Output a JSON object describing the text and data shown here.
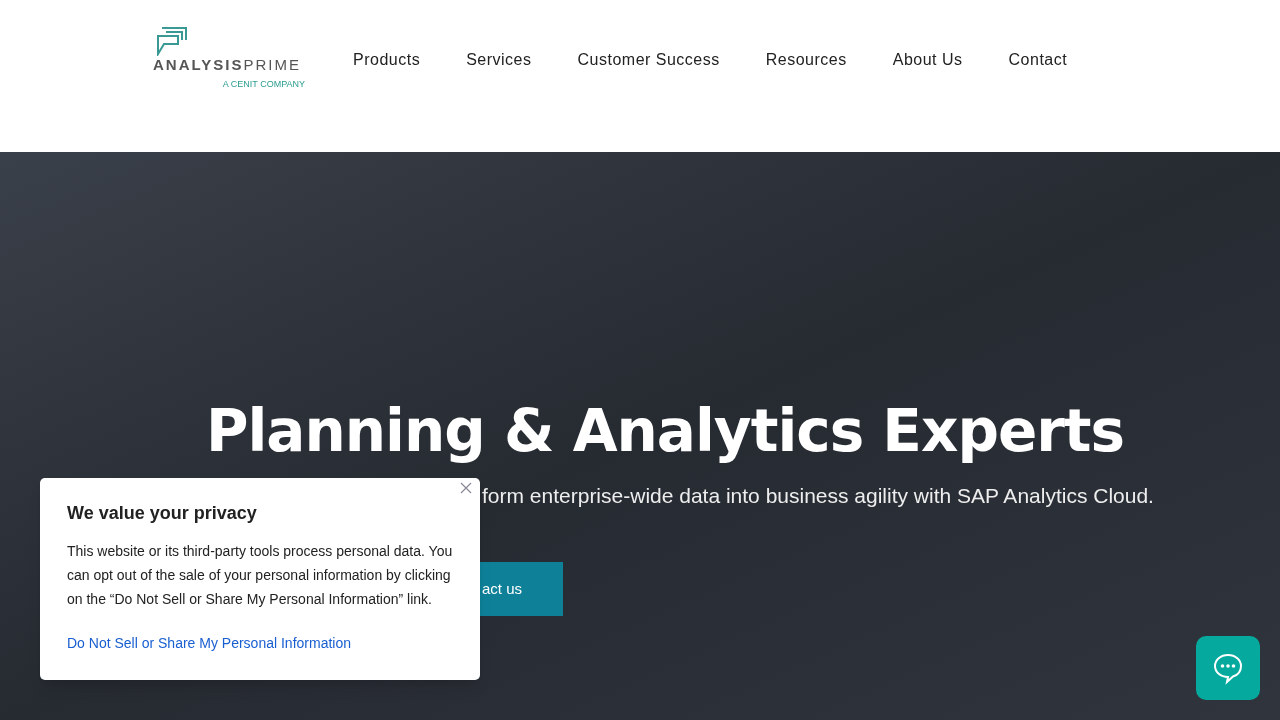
{
  "logo": {
    "wordmark_bold": "ANALYSIS",
    "wordmark_light": "PRIME",
    "tagline": "A CENIT COMPANY"
  },
  "nav": [
    "Products",
    "Services",
    "Customer Success",
    "Resources",
    "About Us",
    "Contact"
  ],
  "hero": {
    "title": "Planning & Analytics Experts",
    "subtitle": "form enterprise-wide data into business agility with SAP Analytics Cloud.",
    "button": "act us"
  },
  "cookie_popup": {
    "title": "We value your privacy",
    "body": "This website or its third-party tools process personal data. You can opt out of the sale of your personal information by clicking on the “Do Not Sell or Share My Personal Information” link.",
    "link": "Do Not Sell or Share My Personal Information"
  }
}
